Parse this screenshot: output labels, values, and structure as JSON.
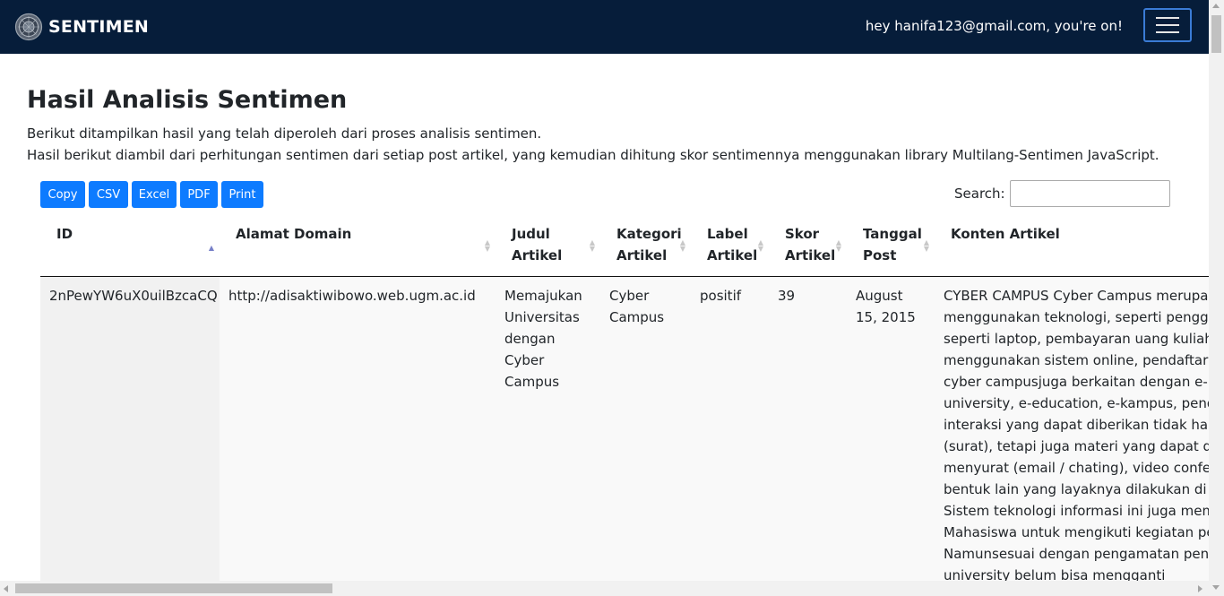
{
  "navbar": {
    "brand": "SENTIMEN",
    "logo_icon": "university-seal-icon",
    "greeting": "hey hanifa123@gmail.com, you're on!",
    "menu_icon": "hamburger-menu-icon"
  },
  "page": {
    "title": "Hasil Analisis Sentimen",
    "description_1": "Berikut ditampilkan hasil yang telah diperoleh dari proses analisis sentimen.",
    "description_2": "Hasil berikut diambil dari perhitungan sentimen dari setiap post artikel, yang kemudian dihitung skor sentimennya menggunakan library Multilang-Sentimen JavaScript."
  },
  "toolbar": {
    "buttons": [
      "Copy",
      "CSV",
      "Excel",
      "PDF",
      "Print"
    ],
    "search_label": "Search:",
    "search_value": ""
  },
  "table": {
    "columns": [
      "ID",
      "Alamat Domain",
      "Judul Artikel",
      "Kategori Artikel",
      "Label Artikel",
      "Skor Artikel",
      "Tanggal Post",
      "Konten Artikel"
    ],
    "sorted_column": "ID",
    "rows": [
      {
        "id": "2nPewYW6uX0uilBzcaCQ",
        "domain": "http://adisaktiwibowo.web.ugm.ac.id",
        "judul": "Memajukan Universitas dengan Cyber Campus",
        "kategori": "Cyber Campus",
        "label": "positif",
        "skor": "39",
        "tanggal": "August 15, 2015",
        "konten": "CYBER CAMPUS Cyber Campus merupakan kampus yang menggunakan teknologi, seperti penggunaan alat elektronik seperti laptop, pembayaran uang kuliah dengan ATM, ujian menggunakan sistem online, pendaftaran online. Selain itu cyber campusjuga berkaitan dengan e-learning, , virtual university, e-education, e-kampus, pendidikan jarak jauh. interaksi yang dapat diberikan tidak hanya interaksi yang pasif (surat), tetapi juga materi yang dapat diberikan melalui surat-menyurat (email / chating), video conference, maupun bentuk-bentuk lain yang layaknya dilakukan di universitas tradisional. Sistem teknologi informasi ini juga mempermudah para Mahasiswa untuk mengikuti kegiatan perkuliahan. Namunsesuai dengan pengamatan penulis, konsep cyber university belum bisa mengganti"
      }
    ]
  },
  "colors": {
    "navbar_bg": "#061d3a",
    "button_bg": "#0d7bff",
    "toggler_border": "#3a7bd5"
  }
}
